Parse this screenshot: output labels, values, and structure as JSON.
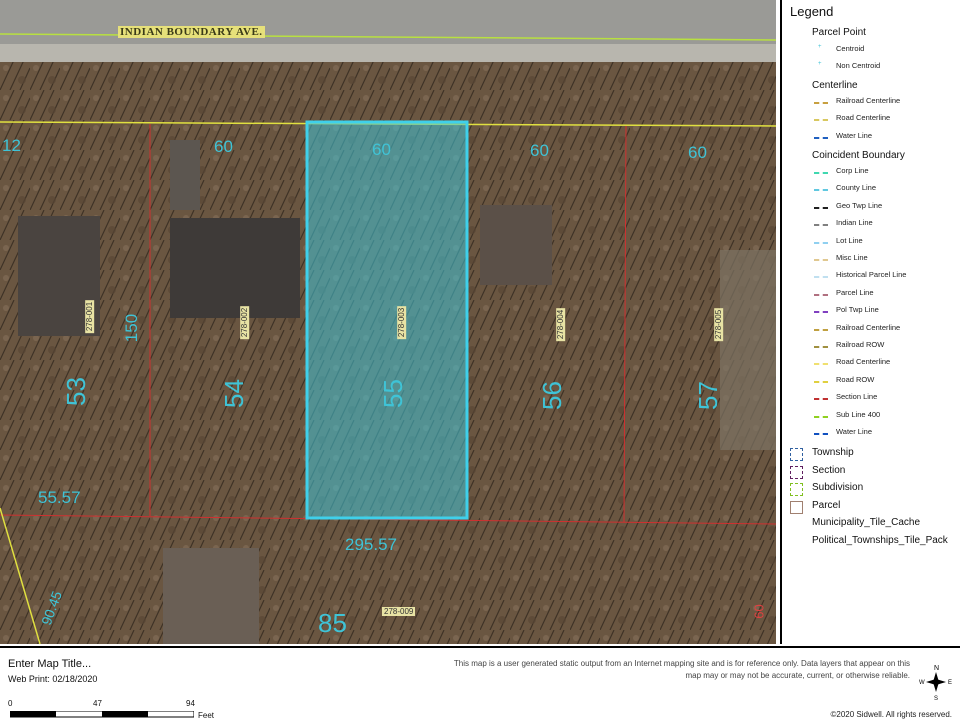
{
  "map": {
    "road_name": "INDIAN BOUNDARY AVE.",
    "frontage_labels": [
      "12",
      "60",
      "60",
      "60",
      "60"
    ],
    "depth_label": "150",
    "lot_numbers": [
      "53",
      "54",
      "55",
      "56",
      "57"
    ],
    "rear_labels": [
      "55.57",
      "295.57",
      "90.45",
      "85",
      "60"
    ],
    "parcel_ids": [
      "278-001",
      "278-002",
      "278-003",
      "278-004",
      "278-005",
      "278-009"
    ],
    "selected_parcel": "55"
  },
  "legend": {
    "title": "Legend",
    "parcel_point": {
      "label": "Parcel Point",
      "items": [
        "Centroid",
        "Non Centroid"
      ]
    },
    "centerline": {
      "label": "Centerline",
      "items": [
        {
          "name": "Railroad Centerline",
          "color": "#c8a040"
        },
        {
          "name": "Road Centerline",
          "color": "#d8c860"
        },
        {
          "name": "Water Line",
          "color": "#2060c0"
        }
      ]
    },
    "coincident": {
      "label": "Coincident Boundary",
      "items": [
        {
          "name": "Corp Line",
          "color": "#40d8b0"
        },
        {
          "name": "County Line",
          "color": "#60c8e0"
        },
        {
          "name": "Geo Twp Line",
          "color": "#202020"
        },
        {
          "name": "Indian Line",
          "color": "#808080"
        },
        {
          "name": "Lot Line",
          "color": "#90d0f0"
        },
        {
          "name": "Misc Line",
          "color": "#e0c890"
        },
        {
          "name": "Historical Parcel Line",
          "color": "#c0e0f0"
        },
        {
          "name": "Parcel Line",
          "color": "#b07080"
        },
        {
          "name": "Pol Twp Line",
          "color": "#8040c0"
        },
        {
          "name": "Railroad Centerline",
          "color": "#c0a040"
        },
        {
          "name": "Railroad ROW",
          "color": "#a09040"
        },
        {
          "name": "Road Centerline",
          "color": "#f0e070"
        },
        {
          "name": "Road ROW",
          "color": "#e0d040"
        },
        {
          "name": "Section Line",
          "color": "#c03030"
        },
        {
          "name": "Sub Line 400",
          "color": "#90d020"
        },
        {
          "name": "Water Line",
          "color": "#1050c0"
        }
      ]
    },
    "boxes": [
      {
        "name": "Township",
        "color": "#3060a0"
      },
      {
        "name": "Section",
        "color": "#602060"
      },
      {
        "name": "Subdivision",
        "color": "#80c020"
      },
      {
        "name": "Parcel",
        "color": "#a08070"
      }
    ],
    "extra": [
      "Municipality_Tile_Cache",
      "Political_Townships_Tile_Pack"
    ]
  },
  "footer": {
    "map_title": "Enter Map Title...",
    "web_print": "Web Print: 02/18/2020",
    "disclaimer": "This map is a user generated static output from an Internet mapping site and is for reference only. Data layers that appear on this map may or may not be accurate, current, or otherwise reliable.",
    "copyright": "©2020 Sidwell. All rights reserved.",
    "scale": {
      "labels": [
        "0",
        "47",
        "94"
      ],
      "unit": "Feet"
    }
  }
}
